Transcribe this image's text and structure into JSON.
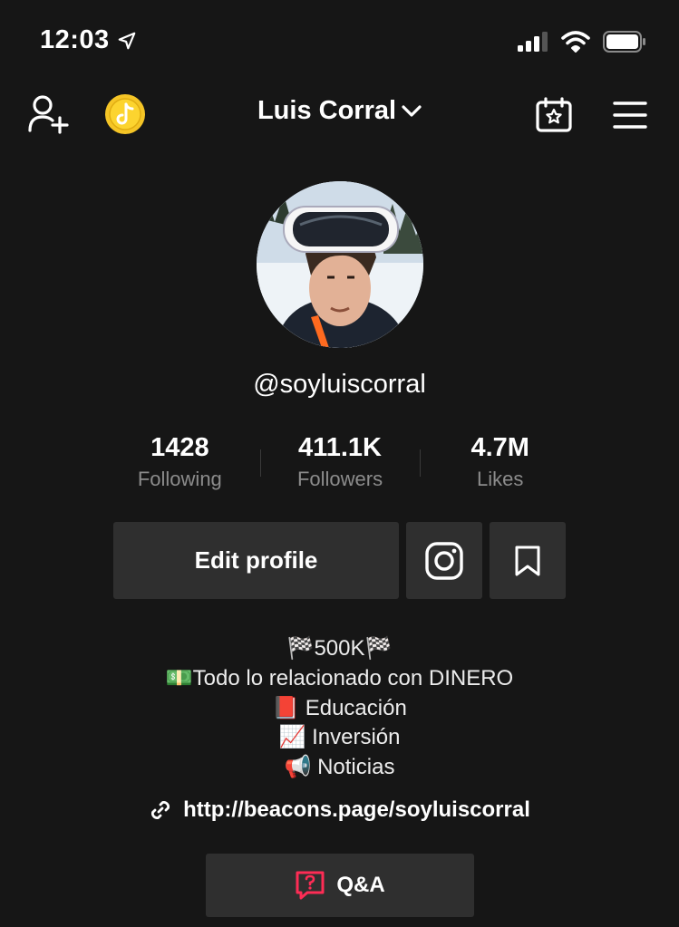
{
  "status_bar": {
    "time": "12:03",
    "icons": [
      "location-arrow-icon",
      "cellular-signal-icon",
      "wifi-icon",
      "battery-icon"
    ]
  },
  "top_nav": {
    "title": "Luis Corral",
    "left_icons": [
      "add-friend-icon",
      "coin-icon"
    ],
    "right_icons": [
      "calendar-star-icon",
      "menu-icon"
    ]
  },
  "profile": {
    "handle": "@soyluiscorral",
    "stats": [
      {
        "value": "1428",
        "label": "Following"
      },
      {
        "value": "411.1K",
        "label": "Followers"
      },
      {
        "value": "4.7M",
        "label": "Likes"
      }
    ],
    "edit_button_label": "Edit profile",
    "bio_lines": [
      "🏁500K🏁",
      "💵Todo lo relacionado con DINERO",
      "📕 Educación",
      "📈 Inversión",
      "📢 Noticias"
    ],
    "link": "http://beacons.page/soyluiscorral",
    "qa_label": "Q&A"
  },
  "colors": {
    "background": "#161616",
    "button_bg": "#2f2f2f",
    "muted_text": "#8c8c8c",
    "coin": "#f5c526",
    "qa_accent": "#fe2c55"
  }
}
